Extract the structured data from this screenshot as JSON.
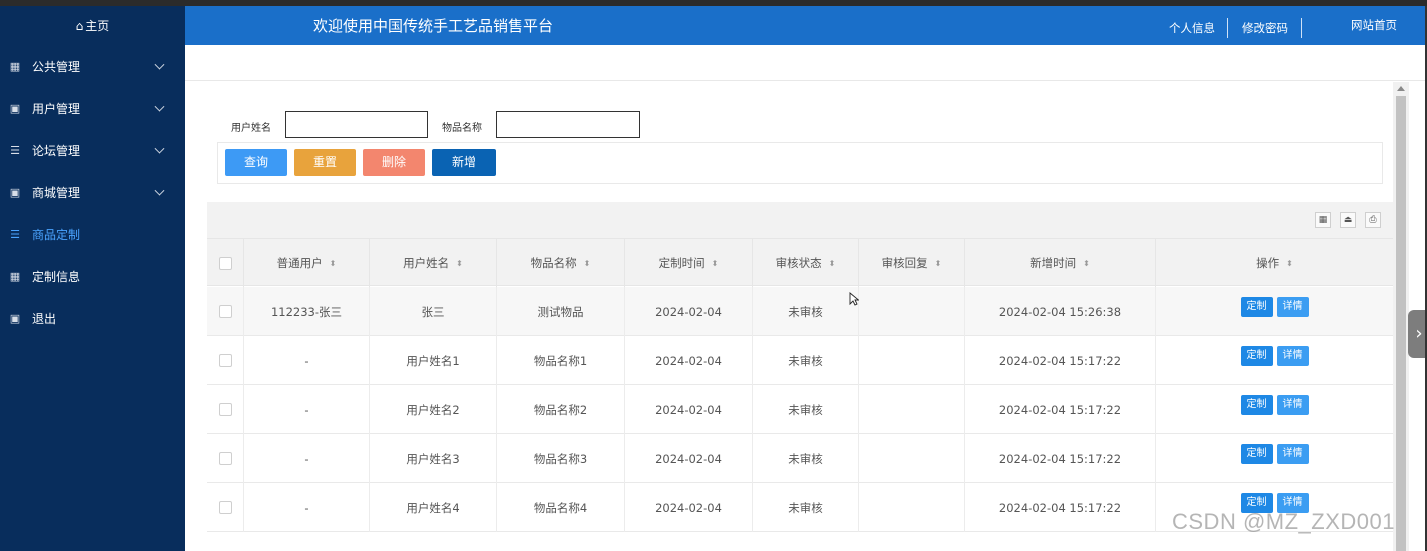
{
  "sidebar": {
    "home": "主页",
    "items": [
      {
        "label": "公共管理",
        "icon": "grid-icon",
        "glyph": "▦",
        "expandable": true,
        "active": false
      },
      {
        "label": "用户管理",
        "icon": "book-icon",
        "glyph": "▣",
        "expandable": true,
        "active": false
      },
      {
        "label": "论坛管理",
        "icon": "list-icon",
        "glyph": "☰",
        "expandable": true,
        "active": false
      },
      {
        "label": "商城管理",
        "icon": "book-icon",
        "glyph": "▣",
        "expandable": true,
        "active": false
      },
      {
        "label": "商品定制",
        "icon": "list-icon",
        "glyph": "☰",
        "expandable": false,
        "active": true
      },
      {
        "label": "定制信息",
        "icon": "grid-icon",
        "glyph": "▦",
        "expandable": false,
        "active": false
      },
      {
        "label": "退出",
        "icon": "book-icon",
        "glyph": "▣",
        "expandable": false,
        "active": false
      }
    ]
  },
  "header": {
    "title": "欢迎使用中国传统手工艺品销售平台",
    "links": {
      "profile": "个人信息",
      "password": "修改密码",
      "site_home": "网站首页"
    }
  },
  "search": {
    "username_label": "用户姓名",
    "username_value": "",
    "item_label": "物品名称",
    "item_value": ""
  },
  "buttons": {
    "query": "查询",
    "reset": "重置",
    "delete": "删除",
    "add": "新增"
  },
  "colors": {
    "sidebar": "#082d5c",
    "header": "#1a6fc9",
    "query": "#3d9af5",
    "reset": "#e8a33c",
    "delete": "#f3866e",
    "add": "#0a63b3",
    "active": "#4aa3ff"
  },
  "table": {
    "columns": [
      "普通用户",
      "用户姓名",
      "物品名称",
      "定制时间",
      "审核状态",
      "审核回复",
      "新增时间",
      "操作"
    ],
    "sort_glyph": "⬍",
    "row_actions": {
      "customize": "定制",
      "detail": "详情"
    },
    "rows": [
      {
        "user": "112233-张三",
        "name": "张三",
        "item": "测试物品",
        "date": "2024-02-04",
        "status": "未审核",
        "reply": "",
        "created": "2024-02-04 15:26:38"
      },
      {
        "user": "-",
        "name": "用户姓名1",
        "item": "物品名称1",
        "date": "2024-02-04",
        "status": "未审核",
        "reply": "",
        "created": "2024-02-04 15:17:22"
      },
      {
        "user": "-",
        "name": "用户姓名2",
        "item": "物品名称2",
        "date": "2024-02-04",
        "status": "未审核",
        "reply": "",
        "created": "2024-02-04 15:17:22"
      },
      {
        "user": "-",
        "name": "用户姓名3",
        "item": "物品名称3",
        "date": "2024-02-04",
        "status": "未审核",
        "reply": "",
        "created": "2024-02-04 15:17:22"
      },
      {
        "user": "-",
        "name": "用户姓名4",
        "item": "物品名称4",
        "date": "2024-02-04",
        "status": "未审核",
        "reply": "",
        "created": "2024-02-04 15:17:22"
      }
    ]
  },
  "watermark": "CSDN @MZ_ZXD001"
}
